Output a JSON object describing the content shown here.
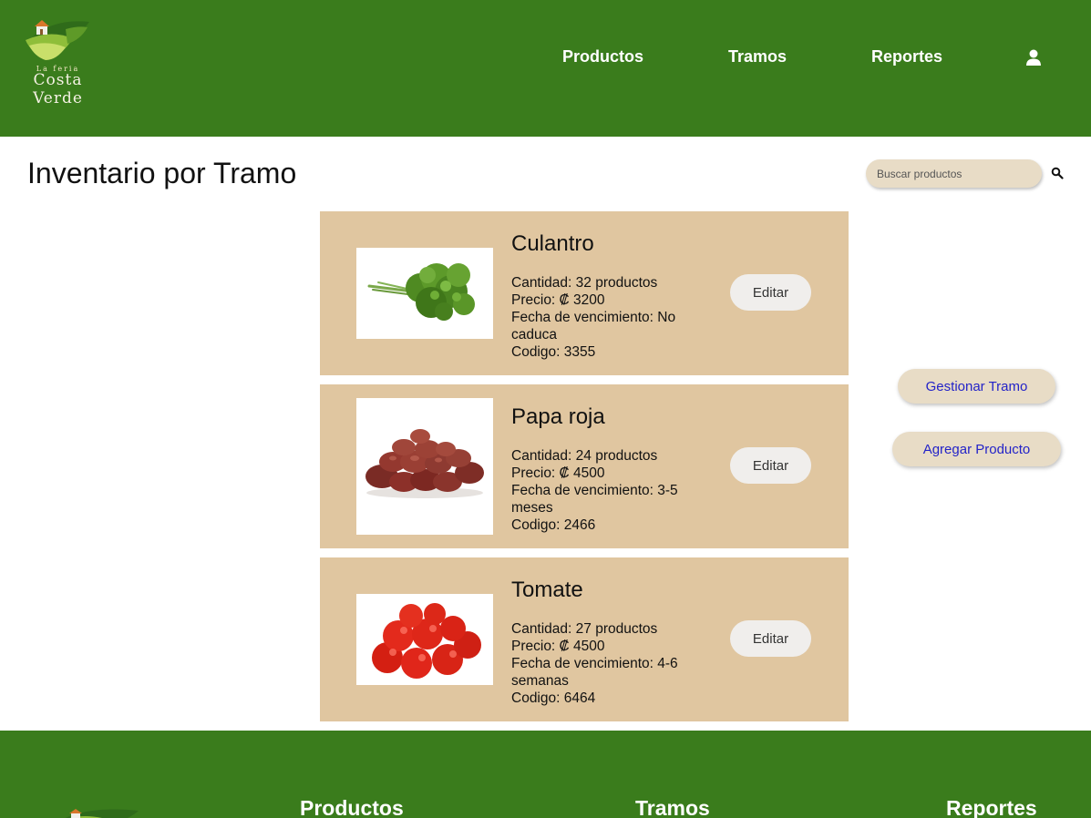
{
  "header": {
    "logo_tagline": "La feria",
    "logo_brand": "Costa Verde",
    "nav": {
      "products": "Productos",
      "tramos": "Tramos",
      "reportes": "Reportes"
    }
  },
  "page": {
    "title": "Inventario por Tramo"
  },
  "search": {
    "placeholder": "Buscar productos"
  },
  "products": [
    {
      "name": "Culantro",
      "cantidad": "Cantidad: 32 productos",
      "precio": "Precio: ₡ 3200",
      "vencimiento": "Fecha de vencimiento: No caduca",
      "codigo": "Codigo: 3355",
      "edit_label": "Editar"
    },
    {
      "name": "Papa roja",
      "cantidad": "Cantidad: 24 productos",
      "precio": "Precio: ₡ 4500",
      "vencimiento": "Fecha de vencimiento: 3-5 meses",
      "codigo": "Codigo: 2466",
      "edit_label": "Editar"
    },
    {
      "name": "Tomate",
      "cantidad": "Cantidad: 27 productos",
      "precio": "Precio: ₡ 4500",
      "vencimiento": "Fecha de vencimiento: 4-6 semanas",
      "codigo": "Codigo: 6464",
      "edit_label": "Editar"
    }
  ],
  "actions": {
    "gestionar": "Gestionar Tramo",
    "agregar": "Agregar Producto"
  },
  "footer": {
    "products": "Productos",
    "tramos": "Tramos",
    "reportes": "Reportes"
  },
  "colors": {
    "header_bg": "#3a7c1c",
    "card_bg": "#e0c6a0",
    "button_bg": "#e8dcc6",
    "link_text": "#2323c8"
  }
}
